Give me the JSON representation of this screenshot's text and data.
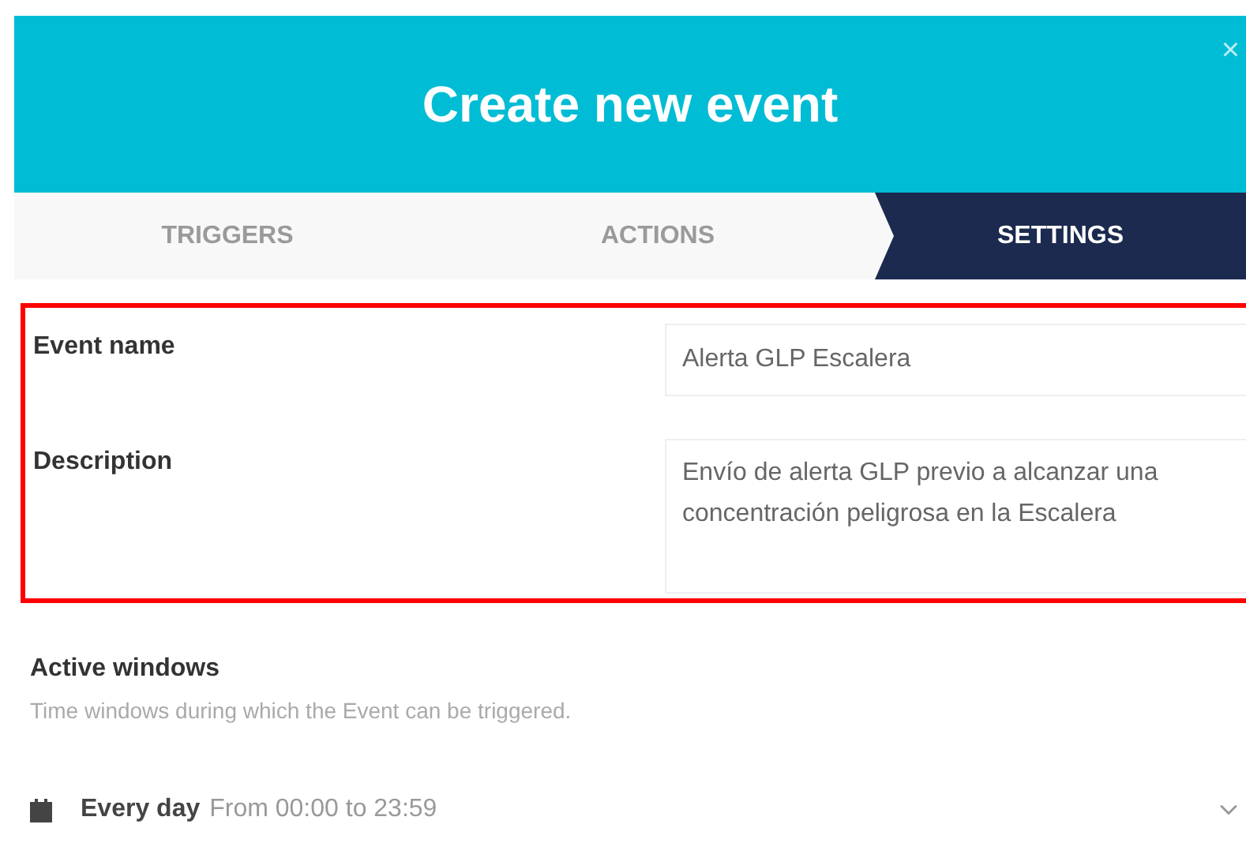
{
  "dialog": {
    "title": "Create new event",
    "close": "×"
  },
  "tabs": [
    {
      "label": "TRIGGERS",
      "selected": false
    },
    {
      "label": "ACTIONS",
      "selected": false
    },
    {
      "label": "SETTINGS",
      "selected": true
    }
  ],
  "fields": [
    {
      "label": "Event name",
      "kind": "input",
      "value": "Alerta GLP Escalera"
    },
    {
      "label": "Description",
      "kind": "textarea",
      "value": "Envío de alerta GLP previo a alcanzar una concentración peligrosa en la Escalera"
    }
  ],
  "active_windows": {
    "title": "Active windows",
    "hint": "Time windows during which the Event can be triggered.",
    "items": [
      {
        "name": "Every day",
        "range": "From 00:00 to 23:59",
        "expanded": false
      }
    ]
  }
}
